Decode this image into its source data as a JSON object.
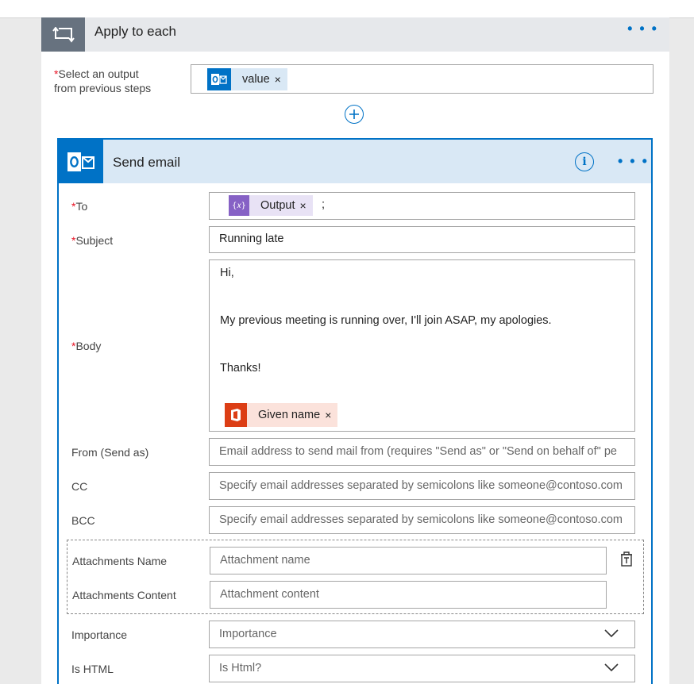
{
  "apply_each": {
    "title": "Apply to each",
    "more_label": "• • •",
    "select_output_label_line1": "Select an output",
    "select_output_label_line2": "from previous steps",
    "required_mark": "*",
    "value_token": "value",
    "token_remove": "×"
  },
  "send_email": {
    "title": "Send email",
    "info_label": "i",
    "more_label": "• • •",
    "fields": {
      "to_label": "To",
      "to_token": "Output",
      "to_separator": ";",
      "subject_label": "Subject",
      "subject_value": "Running late",
      "body_label": "Body",
      "body_line1": "Hi,",
      "body_line2": "My previous meeting is running over, I'll join ASAP, my apologies.",
      "body_line3": "Thanks!",
      "body_token": "Given name",
      "from_label": "From (Send as)",
      "from_placeholder": "Email address to send mail from (requires \"Send as\" or \"Send on behalf of\" pe",
      "cc_label": "CC",
      "cc_placeholder": "Specify email addresses separated by semicolons like someone@contoso.com",
      "bcc_label": "BCC",
      "bcc_placeholder": "Specify email addresses separated by semicolons like someone@contoso.com",
      "attach_name_label": "Attachments Name",
      "attach_name_placeholder": "Attachment name",
      "attach_content_label": "Attachments Content",
      "attach_content_placeholder": "Attachment content",
      "importance_label": "Importance",
      "importance_placeholder": "Importance",
      "ishtml_label": "Is HTML",
      "ishtml_placeholder": "Is Html?"
    }
  },
  "colors": {
    "accent": "#0072c6",
    "required": "#e81123",
    "outlook_blue": "#0072c6",
    "office_orange": "#dc3e15",
    "expression_purple": "#8661c5"
  }
}
